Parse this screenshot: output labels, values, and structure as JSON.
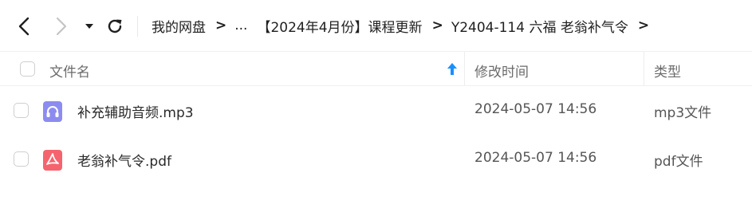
{
  "nav": {
    "back_icon": "chevron-left-icon",
    "forward_icon": "chevron-right-icon",
    "dropdown_icon": "caret-down-icon",
    "refresh_icon": "refresh-icon"
  },
  "breadcrumb": {
    "root": "我的网盘",
    "separator": ">",
    "ellipsis": "...",
    "items": [
      "【2024年4月份】课程更新",
      "Y2404-114 六福 老翁补气令"
    ]
  },
  "table": {
    "columns": {
      "name": "文件名",
      "modified": "修改时间",
      "type": "类型"
    },
    "sort_color": "#1890ff",
    "rows": [
      {
        "name": "补充辅助音频.mp3",
        "modified": "2024-05-07 14:56",
        "type": "mp3文件",
        "icon": "audio-file-icon",
        "icon_color": "#8c8cf0"
      },
      {
        "name": "老翁补气令.pdf",
        "modified": "2024-05-07 14:56",
        "type": "pdf文件",
        "icon": "pdf-file-icon",
        "icon_color": "#f5646e"
      }
    ]
  }
}
